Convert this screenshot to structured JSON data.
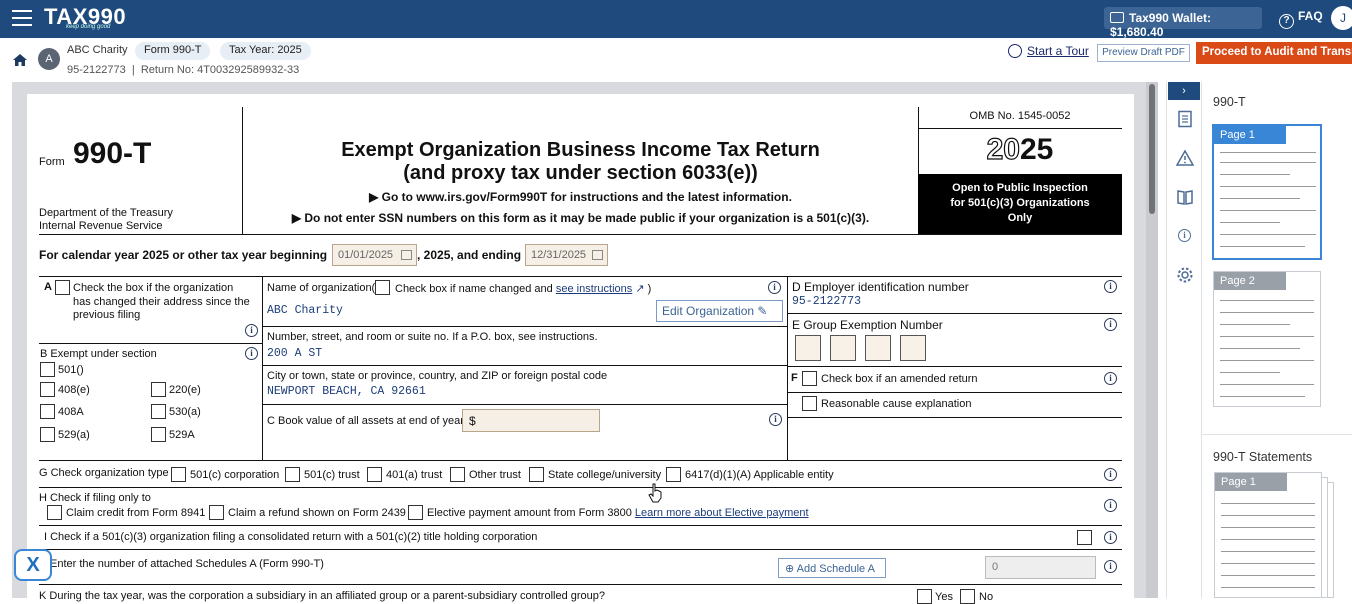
{
  "topbar": {
    "logo": "TAX990",
    "logo_tagline": "keep doing good",
    "wallet": "Tax990 Wallet: $1,680.40",
    "faq": "FAQ",
    "user_initial": "J"
  },
  "subbar": {
    "avatar_initial": "A",
    "org_name": "ABC Charity",
    "form_chip": "Form 990-T",
    "year_chip": "Tax Year: 2025",
    "ein": "95-2122773",
    "return_no": "Return No: 4T003292589932-33",
    "start_tour": "Start a Tour",
    "preview_pdf": "Preview Draft PDF",
    "proceed": "Proceed to Audit and Transmit"
  },
  "form": {
    "form_label": "Form",
    "form_number": "990-T",
    "dept1": "Department of the Treasury",
    "dept2": "Internal Revenue Service",
    "title1": "Exempt Organization Business Income Tax Return",
    "title2": "(and proxy tax under section 6033(e))",
    "goto": "▶ Go to www.irs.gov/Form990T for instructions and the latest information.",
    "ssn_note": "▶ Do not enter SSN numbers on this form as it may be made public if your organization is a 501(c)(3).",
    "omb": "OMB No. 1545-0052",
    "year_outline": "20",
    "year_solid": "25",
    "open_inspection": "Open to Public Inspection for 501(c)(3) Organizations Only",
    "calendar_prefix": "For calendar year 2025 or other tax year beginning",
    "begin_date": "01/01/2025",
    "calendar_mid": ", 2025, and ending",
    "end_date": "12/31/2025",
    "a_letter": "A",
    "a_text": "Check the box if the organization has changed their address since the previous filing",
    "b_label": "B Exempt under section",
    "b_options": [
      "501()",
      "408(e)",
      "220(e)",
      "408A",
      "530(a)",
      "529(a)",
      "529A"
    ],
    "name_label": "Name of organization(",
    "name_changed": "Check box if name changed and",
    "see_instructions": "see instructions",
    "name_close": ")",
    "org_name_value": "ABC Charity",
    "edit_org": "Edit Organization",
    "street_label": "Number, street, and room or suite no. If a P.O. box, see instructions.",
    "street_value": "200 A ST",
    "city_label": "City or town, state or province, country, and ZIP or foreign postal code",
    "city_value": "NEWPORT BEACH, CA 92661",
    "c_label": "C  Book value of all assets at end of year",
    "c_value": "$",
    "d_label": "D Employer identification number",
    "d_value": "95-2122773",
    "e_label": "E Group Exemption Number",
    "f_letter": "F",
    "f_amended": "Check box if an amended return",
    "f_reasonable": "Reasonable cause explanation",
    "g_label": "G Check organization type",
    "g_options": [
      "501(c) corporation",
      "501(c) trust",
      "401(a) trust",
      "Other trust",
      "State college/university",
      "6417(d)(1)(A) Applicable entity"
    ],
    "h_label": "H Check if filing only to",
    "h_options": [
      "Claim credit from Form 8941",
      "Claim a refund shown on Form 2439",
      "Elective payment amount from Form 3800"
    ],
    "h_link": "Learn more about Elective payment",
    "i_label": "I  Check if a 501(c)(3) organization filing a consolidated return with a 501(c)(2) title holding corporation",
    "j_label": "Enter the number of attached Schedules A (Form 990-T)",
    "add_schedule": "Add Schedule A",
    "j_value": "0",
    "k_label": "K During the tax year, was the corporation a subsidiary in an affiliated group or a parent-subsidiary controlled group?",
    "k_yes": "Yes",
    "k_no": "No"
  },
  "right_panel": {
    "section1": "990-T",
    "page1": "Page 1",
    "page2": "Page 2",
    "section2": "990-T Statements",
    "stmt_page1": "Page 1"
  },
  "icons": [
    "menu-icon",
    "wallet-icon",
    "help-icon",
    "home-icon",
    "tour-icon",
    "calendar-icon",
    "info-icon",
    "external-link-icon",
    "edit-icon",
    "plus-icon",
    "chevron-right-icon",
    "document-icon",
    "warning-icon",
    "book-icon",
    "settings-icon",
    "chat-assistant-icon"
  ],
  "colors": {
    "header": "#1e4a7d",
    "proceed": "#d94a17",
    "value_text": "#1d3d7a"
  }
}
